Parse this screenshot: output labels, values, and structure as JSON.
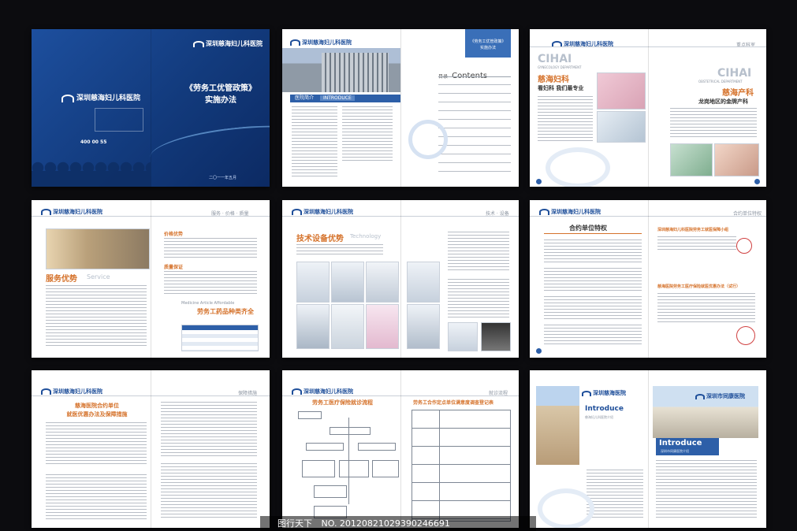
{
  "cover": {
    "logo": "深圳慈海妇儿科医院",
    "logo_small": "深圳慈海妇儿科医院",
    "title_line1": "《劳务工优管政策》",
    "title_line2": "实施办法",
    "phone": "400 00 55",
    "date": "二〇一一年五月"
  },
  "toc": {
    "logo": "深圳慈海妇儿科医院",
    "section_cn": "医院简介",
    "section_en": "INTRODUCE",
    "badge_line1": "《劳务工优管政策》",
    "badge_line2": "实施办法",
    "contents_cn": "目录",
    "contents_en": "Contents"
  },
  "dept": {
    "logo": "深圳慈海妇儿科医院",
    "header": "重点科室",
    "left_en": "CIHAI",
    "left_sub": "GYNECOLOGY DEPARTMENT",
    "left_cn": "慈海妇科",
    "left_slogan": "看妇科  我们最专业",
    "right_en": "CIHAI",
    "right_sub": "OBSTETRICAL DEPARTMENT",
    "right_cn": "慈海产科",
    "right_slogan": "龙岗地区的金牌产科"
  },
  "service": {
    "logo": "深圳慈海妇儿科医院",
    "header": "服务 · 价格 · 质量",
    "title_cn": "服务优势",
    "title_en": "Service",
    "price": "价格优势",
    "quality": "质量保证",
    "medicine_en": "Medicine Article Affordable",
    "medicine_cn": "劳务工药品种类齐全"
  },
  "tech": {
    "logo": "深圳慈海妇儿科医院",
    "header": "技术 · 设备",
    "title_cn": "技术设备优势",
    "title_en": "Technology"
  },
  "contract": {
    "logo": "深圳慈海妇儿科医院",
    "header": "合约单位特权",
    "title": "合约单位特权",
    "right_title": "深圳慈海妇儿科医院劳务工就医保障小组",
    "right_sub": "慈海医院劳务工医疗保险就医优惠办法（试行）"
  },
  "policy": {
    "logo": "深圳慈海妇儿科医院",
    "header": "保障措施",
    "title_line1": "慈海医院合约单位",
    "title_line2": "就医优惠办法及保障措施"
  },
  "flow": {
    "logo": "深圳慈海妇儿科医院",
    "header": "就诊流程",
    "left_title": "劳务工医疗保险就诊流程",
    "right_title": "劳务工合作定点单位满意度调查登记表"
  },
  "intro": {
    "brand_left": "深圳慈海医院",
    "brand_right": "深圳市同康医院",
    "intro_left": "Introduce",
    "intro_sub_left": "慈海妇儿科医院介绍",
    "intro_right": "Introduce",
    "intro_sub_right": "深圳市同康医院介绍"
  },
  "footer": {
    "watermark": "图行天下",
    "code": "NO. 20120821029390246691"
  },
  "colors": {
    "brand_blue": "#1f4f9a",
    "accent_orange": "#d5722b",
    "background": "#0c0c0f"
  }
}
